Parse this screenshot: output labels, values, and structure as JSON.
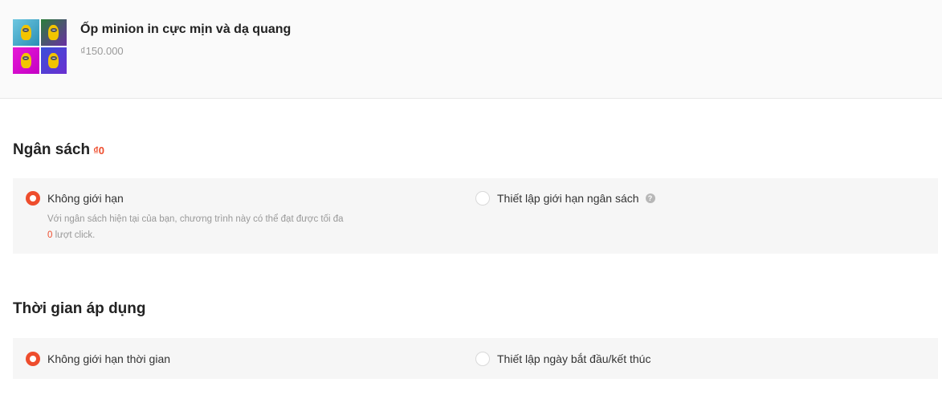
{
  "product": {
    "name": "Ốp minion in cực mịn và dạ quang",
    "price": "₫150.000",
    "thumbnail_colors": [
      "#6ec7e0",
      "#2b7d3a",
      "#e61ad6",
      "#3a4fd8"
    ]
  },
  "budget": {
    "title": "Ngân sách",
    "amount": "₫0",
    "options": [
      {
        "label": "Không giới hạn",
        "selected": true
      },
      {
        "label": "Thiết lập giới hạn ngân sách",
        "selected": false
      }
    ],
    "hint_line1": "Với ngân sách hiện tại của bạn, chương trình này có thể đạt được tối đa",
    "hint_count": "0",
    "hint_line2_suffix": " lượt click.",
    "help_icon": "question-icon"
  },
  "schedule": {
    "title": "Thời gian áp dụng",
    "options": [
      {
        "label": "Không giới hạn thời gian",
        "selected": true
      },
      {
        "label": "Thiết lập ngày bắt đầu/kết thúc",
        "selected": false
      }
    ]
  },
  "colors": {
    "accent": "#ee4d2d",
    "panel_bg": "#f6f6f6",
    "muted_text": "#999999"
  }
}
